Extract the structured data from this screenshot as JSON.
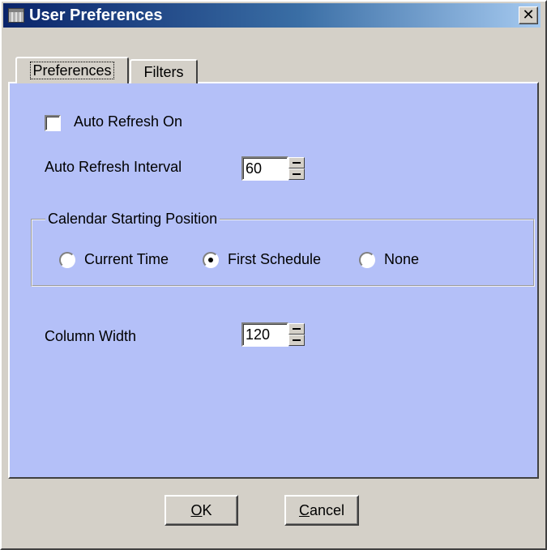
{
  "window": {
    "title": "User Preferences",
    "close_glyph": "✕",
    "app_icon": "grid-app-icon"
  },
  "tabs": [
    {
      "label": "Preferences",
      "active": true
    },
    {
      "label": "Filters",
      "active": false
    }
  ],
  "colors": {
    "titlebar_start": "#0a246a",
    "titlebar_end": "#a6caf0",
    "panel_background": "#b4c0f8",
    "dialog_background": "#d4d0c8"
  },
  "preferences": {
    "auto_refresh": {
      "label": "Auto Refresh On",
      "checked": false
    },
    "refresh_interval": {
      "label": "Auto Refresh Interval",
      "value": "60"
    },
    "calendar_start": {
      "group_label": "Calendar Starting Position",
      "options": [
        {
          "label": "Current Time",
          "selected": false
        },
        {
          "label": "First Schedule",
          "selected": true
        },
        {
          "label": "None",
          "selected": false
        }
      ]
    },
    "column_width": {
      "label": "Column Width",
      "value": "120"
    }
  },
  "buttons": {
    "ok": {
      "mnemonic": "O",
      "rest": "K"
    },
    "cancel": {
      "mnemonic": "C",
      "rest": "ancel"
    }
  }
}
